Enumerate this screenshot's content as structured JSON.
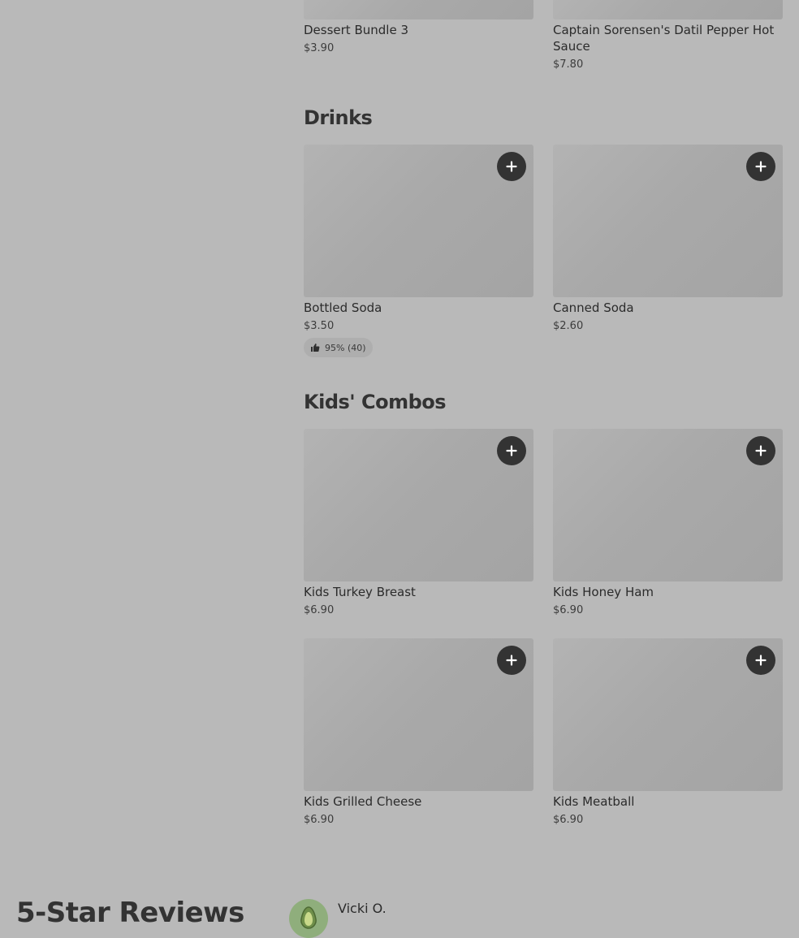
{
  "top_items": [
    {
      "name": "Dessert Bundle 3",
      "price": "$3.90"
    },
    {
      "name": "Captain Sorensen's Datil Pepper Hot Sauce",
      "price": "$7.80"
    }
  ],
  "sections": {
    "drinks": {
      "title": "Drinks",
      "items": [
        {
          "name": "Bottled Soda",
          "price": "$3.50",
          "rating": "95% (40)"
        },
        {
          "name": "Canned Soda",
          "price": "$2.60"
        }
      ]
    },
    "kids_combos": {
      "title": "Kids' Combos",
      "items": [
        {
          "name": "Kids Turkey Breast",
          "price": "$6.90"
        },
        {
          "name": "Kids Honey Ham",
          "price": "$6.90"
        },
        {
          "name": "Kids Grilled Cheese",
          "price": "$6.90"
        },
        {
          "name": "Kids Meatball",
          "price": "$6.90"
        }
      ]
    }
  },
  "reviews": {
    "title": "5-Star Reviews",
    "first_reviewer": "Vicki O."
  },
  "icons": {
    "add": "plus-icon",
    "rating": "thumbs-up-icon",
    "avatar": "avocado-icon"
  },
  "colors": {
    "background": "#b9b9b9",
    "button": "#333333",
    "avatar_bg": "#8fae7c"
  }
}
